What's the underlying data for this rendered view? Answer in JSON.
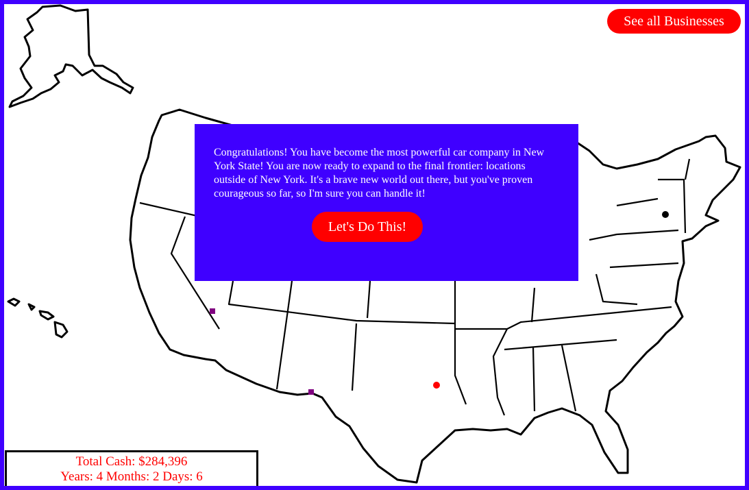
{
  "header": {
    "see_all_label": "See all Businesses"
  },
  "modal": {
    "message": "Congratulations! You have become the most powerful car company in New York State! You are now ready to expand to the final frontier: locations outside of New York. It's a brave new world out there, but you've proven courageous so far, so I'm sure you can handle it!",
    "button_label": "Let's Do This!"
  },
  "stats": {
    "cash": "Total Cash: $284,396",
    "time": "Years: 4 Months: 2 Days: 6"
  },
  "colors": {
    "frame": "#3f00ff",
    "button": "#ff0000",
    "hq_marker": "#000000",
    "business_marker": "#ff0000",
    "location_marker": "#800080"
  },
  "map": {
    "markers": [
      "hq",
      "business",
      "location",
      "location"
    ]
  }
}
